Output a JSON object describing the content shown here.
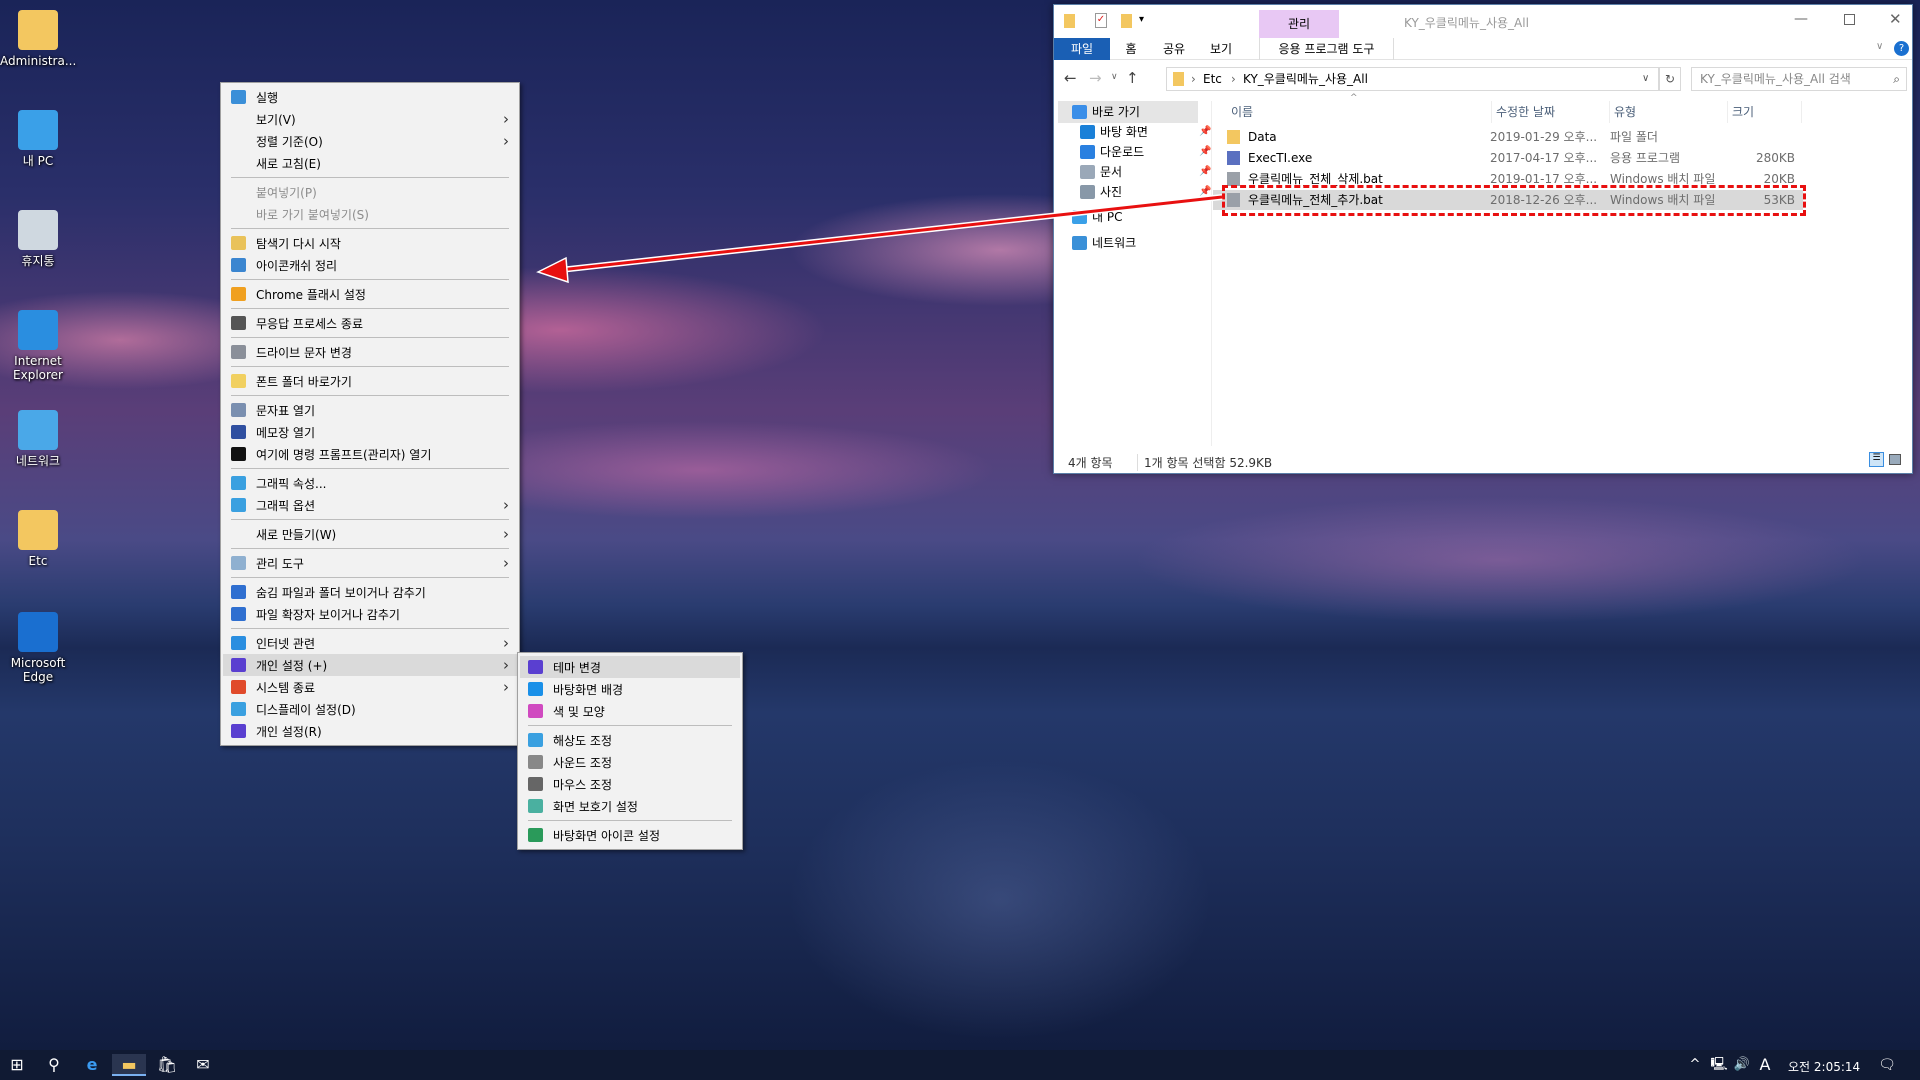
{
  "desktop": {
    "icons": [
      {
        "label": "Administra...",
        "icon": "user-folder-icon",
        "color": "#f3c760"
      },
      {
        "label": "내 PC",
        "icon": "computer-icon",
        "color": "#3aa0e8"
      },
      {
        "label": "휴지통",
        "icon": "recycle-bin-icon",
        "color": "#cfd8e0"
      },
      {
        "label": "Internet Explorer",
        "icon": "internet-explorer-icon",
        "color": "#2a8ee0"
      },
      {
        "label": "네트워크",
        "icon": "network-icon",
        "color": "#4aa8e8"
      },
      {
        "label": "Etc",
        "icon": "folder-icon",
        "color": "#f3c760"
      },
      {
        "label": "Microsoft Edge",
        "icon": "edge-icon",
        "color": "#1a6fd0"
      }
    ]
  },
  "context_menu": {
    "items": [
      {
        "label": "실행",
        "icon": "run-icon",
        "color": "#3b8fd8"
      },
      {
        "label": "보기(V)",
        "sub": true
      },
      {
        "label": "정렬 기준(O)",
        "sub": true
      },
      {
        "label": "새로 고침(E)"
      },
      {
        "sep": true
      },
      {
        "label": "붙여넣기(P)",
        "disabled": true
      },
      {
        "label": "바로 가기 붙여넣기(S)",
        "disabled": true
      },
      {
        "sep": true
      },
      {
        "label": "탐색기 다시 시작",
        "icon": "explorer-folder-icon",
        "color": "#e9c25a"
      },
      {
        "label": "아이콘캐쉬 정리",
        "icon": "recycle-icon",
        "color": "#3b86d0"
      },
      {
        "sep": true
      },
      {
        "label": "Chrome 플래시 설정",
        "icon": "chrome-icon",
        "color": "#f0a020"
      },
      {
        "sep": true
      },
      {
        "label": "무응답 프로세스 종료",
        "icon": "knife-icon",
        "color": "#555555"
      },
      {
        "sep": true
      },
      {
        "label": "드라이브 문자 변경",
        "icon": "drive-icon",
        "color": "#8a8f99"
      },
      {
        "sep": true
      },
      {
        "label": "폰트 폴더 바로가기",
        "icon": "font-icon",
        "color": "#f1d060"
      },
      {
        "sep": true
      },
      {
        "label": "문자표 열기",
        "icon": "charmap-icon",
        "color": "#7a8fb0"
      },
      {
        "label": "메모장 열기",
        "icon": "notepad-icon",
        "color": "#2f4fa0"
      },
      {
        "label": "여기에 명령 프롬프트(관리자) 열기",
        "icon": "cmd-icon",
        "color": "#111111"
      },
      {
        "sep": true
      },
      {
        "label": "그래픽 속성...",
        "icon": "graphics-icon",
        "color": "#3aa0e0"
      },
      {
        "label": "그래픽 옵션",
        "icon": "graphics-icon",
        "color": "#3aa0e0",
        "sub": true
      },
      {
        "sep": true
      },
      {
        "label": "새로 만들기(W)",
        "sub": true
      },
      {
        "sep": true
      },
      {
        "label": "관리 도구",
        "icon": "gear-icon",
        "color": "#8fb0d0",
        "sub": true
      },
      {
        "sep": true
      },
      {
        "label": "숨김 파일과 폴더 보이거나 감추기",
        "icon": "shield-icon",
        "color": "#2f6fd0"
      },
      {
        "label": "파일 확장자 보이거나 감추기",
        "icon": "shield-icon",
        "color": "#2f6fd0"
      },
      {
        "sep": true
      },
      {
        "label": "인터넷 관련",
        "icon": "internet-explorer-icon",
        "color": "#2a8ee0",
        "sub": true
      },
      {
        "label": "개인 설정 (+)",
        "icon": "personalize-icon",
        "color": "#5a3fd0",
        "sub": true,
        "highlighted": true
      },
      {
        "label": "시스템 종료",
        "icon": "power-icon",
        "color": "#e04a2a",
        "sub": true
      },
      {
        "label": "디스플레이 설정(D)",
        "icon": "display-icon",
        "color": "#3aa0e0"
      },
      {
        "label": "개인 설정(R)",
        "icon": "personalize-icon",
        "color": "#5a3fd0"
      }
    ]
  },
  "submenu": {
    "items": [
      {
        "label": "테마 변경",
        "icon": "personalize-icon",
        "color": "#5a3fd0",
        "highlighted": true
      },
      {
        "label": "바탕화면 배경",
        "icon": "wallpaper-icon",
        "color": "#1a90e8"
      },
      {
        "label": "색 및 모양",
        "icon": "color-icon",
        "color": "#d04ac0"
      },
      {
        "sep": true
      },
      {
        "label": "해상도 조정",
        "icon": "display-icon",
        "color": "#3aa0e0"
      },
      {
        "label": "사운드 조정",
        "icon": "speaker-icon",
        "color": "#888888"
      },
      {
        "label": "마우스 조정",
        "icon": "mouse-icon",
        "color": "#666666"
      },
      {
        "label": "화면 보호기 설정",
        "icon": "screensaver-icon",
        "color": "#4ab0a0"
      },
      {
        "sep": true
      },
      {
        "label": "바탕화면 아이콘 설정",
        "icon": "desktop-icons-icon",
        "color": "#2a9a5a"
      }
    ]
  },
  "explorer": {
    "title": "KY_우클릭메뉴_사용_All",
    "context_tab": "관리",
    "tabs": [
      "파일",
      "홈",
      "공유",
      "보기",
      "응용 프로그램 도구"
    ],
    "breadcrumb": [
      "Etc",
      "KY_우클릭메뉴_사용_All"
    ],
    "search_placeholder": "KY_우클릭메뉴_사용_All 검색",
    "nav": [
      {
        "label": "바로 가기",
        "icon": "star-icon",
        "color": "#3a8ee8"
      },
      {
        "label": "바탕 화면",
        "icon": "desktop-icon",
        "color": "#1a80d8",
        "pin": true
      },
      {
        "label": "다운로드",
        "icon": "download-icon",
        "color": "#2a80e0",
        "pin": true
      },
      {
        "label": "문서",
        "icon": "document-icon",
        "color": "#9aa8b8",
        "pin": true
      },
      {
        "label": "사진",
        "icon": "pictures-icon",
        "color": "#8898a8",
        "pin": true
      },
      {
        "label": "내 PC",
        "icon": "computer-icon",
        "color": "#3aa0e8"
      },
      {
        "label": "네트워크",
        "icon": "network-icon",
        "color": "#3a90d8"
      }
    ],
    "columns": [
      "이름",
      "수정한 날짜",
      "유형",
      "크기"
    ],
    "files": [
      {
        "name": "Data",
        "date": "2019-01-29 오후...",
        "type": "파일 폴더",
        "size": "",
        "icon": "folder-icon",
        "color": "#f3c760"
      },
      {
        "name": "ExecTI.exe",
        "date": "2017-04-17 오후...",
        "type": "응용 프로그램",
        "size": "280KB",
        "icon": "exe-icon",
        "color": "#5a70c0"
      },
      {
        "name": "우클릭메뉴_전체_삭제.bat",
        "date": "2019-01-17 오후...",
        "type": "Windows 배치 파일",
        "size": "20KB",
        "icon": "bat-file-icon",
        "color": "#9aa0a8"
      },
      {
        "name": "우클릭메뉴_전체_추가.bat",
        "date": "2018-12-26 오후...",
        "type": "Windows 배치 파일",
        "size": "53KB",
        "icon": "bat-file-icon",
        "color": "#9aa0a8",
        "selected": true
      }
    ],
    "status_count": "4개 항목",
    "status_selected": "1개 항목 선택함 52.9KB"
  },
  "annotation_color": "#e81010",
  "taskbar": {
    "clock": "오전 2:05:14",
    "ime": "A"
  }
}
